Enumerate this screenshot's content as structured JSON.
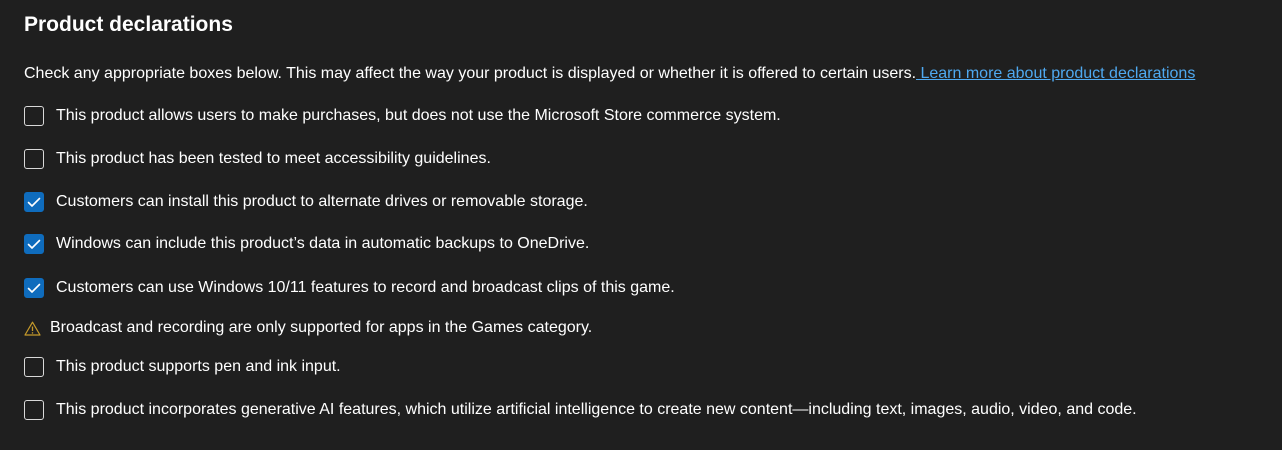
{
  "section": {
    "title": "Product declarations",
    "intro_text": "Check any appropriate boxes below. This may affect the way your product is displayed or whether it is offered to certain users.",
    "learn_more_link": " Learn more about product declarations"
  },
  "colors": {
    "background": "#1f1f1f",
    "accent": "#0f6cbd",
    "link": "#4fa9f0",
    "warning": "#c59a2b"
  },
  "declarations": [
    {
      "label": "This product allows users to make purchases, but does not use the Microsoft Store commerce system.",
      "checked": false
    },
    {
      "label": "This product has been tested to meet accessibility guidelines.",
      "checked": false
    },
    {
      "label": "Customers can install this product to alternate drives or removable storage.",
      "checked": true
    },
    {
      "label": "Windows can include this product’s data in automatic backups to OneDrive.",
      "checked": true
    },
    {
      "label": "Customers can use Windows 10/11 features to record and broadcast clips of this game.",
      "checked": true
    },
    {
      "label": "This product supports pen and ink input.",
      "checked": false
    },
    {
      "label": "This product incorporates generative AI features, which utilize artificial intelligence to create new content—including text, images, audio, video, and code.",
      "checked": false
    }
  ],
  "warning": {
    "icon": "warning-icon",
    "text": "Broadcast and recording are only supported for apps in the Games category."
  }
}
